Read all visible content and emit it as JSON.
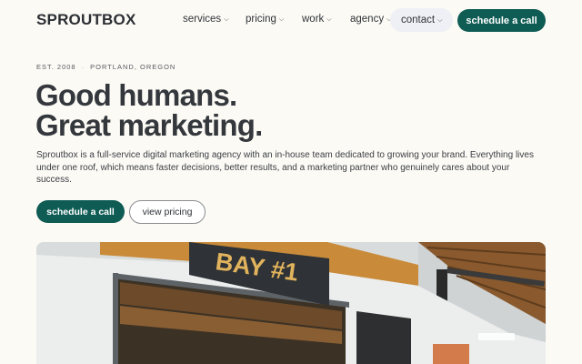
{
  "header": {
    "logo": "SPROUTBOX",
    "nav": [
      {
        "label": "services"
      },
      {
        "label": "pricing"
      },
      {
        "label": "work"
      },
      {
        "label": "agency"
      },
      {
        "label": "contact"
      }
    ],
    "cta_label": "schedule a call"
  },
  "hero": {
    "eyebrow_est": "EST. 2008",
    "eyebrow_location": "PORTLAND, OREGON",
    "headline_line1": "Good humans.",
    "headline_line2": "Great marketing.",
    "description": "Sproutbox is a full-service digital marketing agency with an in-house team dedicated to growing your brand. Everything lives under one roof, which means faster decisions, better results, and a marketing partner who genuinely cares about your success.",
    "primary_button": "schedule a call",
    "secondary_button": "view pricing",
    "photo_sign": "BAY #1"
  },
  "colors": {
    "accent": "#0f5c55",
    "background": "#fcfaf5",
    "active_nav_bg": "#eef0f5"
  },
  "icons": {
    "nav_dropdown": "chevron-down-icon"
  }
}
